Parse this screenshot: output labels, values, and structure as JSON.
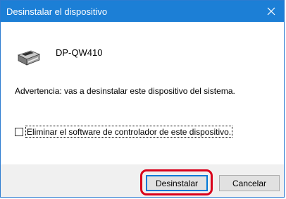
{
  "window": {
    "title": "Desinstalar el dispositivo",
    "close_icon": "close-icon"
  },
  "device": {
    "icon": "printer-icon",
    "name": "DP-QW410"
  },
  "warning_text": "Advertencia: vas a desinstalar este dispositivo del sistema.",
  "option": {
    "label": "Eliminar el software de controlador de este dispositivo.",
    "checked": false
  },
  "buttons": {
    "uninstall": "Desinstalar",
    "cancel": "Cancelar"
  },
  "colors": {
    "titlebar": "#1c7fd6",
    "highlight": "#d9001b",
    "focus": "#0078d7"
  }
}
